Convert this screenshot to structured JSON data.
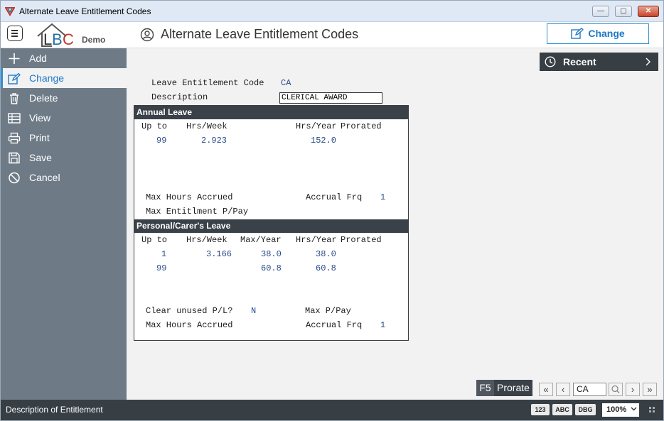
{
  "window": {
    "title": "Alternate Leave Entitlement Codes",
    "buttons": {
      "minimize": "—",
      "maximize": "▢",
      "close": "✕"
    }
  },
  "header": {
    "logo_text": "Demo",
    "page_title": "Alternate Leave Entitlement Codes",
    "mode_button": "Change"
  },
  "sidebar": {
    "items": [
      {
        "label": "Add",
        "icon": "plus-icon"
      },
      {
        "label": "Change",
        "icon": "edit-icon",
        "active": true
      },
      {
        "label": "Delete",
        "icon": "trash-icon"
      },
      {
        "label": "View",
        "icon": "table-icon"
      },
      {
        "label": "Print",
        "icon": "printer-icon"
      },
      {
        "label": "Save",
        "icon": "save-icon"
      },
      {
        "label": "Cancel",
        "icon": "cancel-icon"
      }
    ]
  },
  "recent": {
    "label": "Recent"
  },
  "form": {
    "code_label": "Leave Entitlement Code",
    "code_value": "CA",
    "description_label": "Description",
    "description_value": "CLERICAL AWARD"
  },
  "annual_leave": {
    "header": "Annual Leave",
    "col_upto": "Up to",
    "col_hrs_week": "Hrs/Week",
    "col_hrs_year": "Hrs/Year",
    "col_prorated": "Prorated",
    "rows": [
      {
        "upto": "99",
        "hrs_week": "2.923",
        "hrs_year": "152.0"
      }
    ],
    "max_hours_label": "Max Hours Accrued",
    "accrual_frq_label": "Accrual Frq",
    "accrual_frq_value": "1",
    "max_entitlement_label": "Max Entitlment P/Pay"
  },
  "personal_leave": {
    "header": "Personal/Carer's Leave",
    "col_upto": "Up to",
    "col_hrs_week": "Hrs/Week",
    "col_max_year": "Max/Year",
    "col_hrs_year": "Hrs/Year",
    "col_prorated": "Prorated",
    "rows": [
      {
        "upto": "1",
        "hrs_week": "3.166",
        "max_year": "38.0",
        "hrs_year": "38.0"
      },
      {
        "upto": "99",
        "hrs_week": "",
        "max_year": "60.8",
        "hrs_year": "60.8"
      }
    ],
    "clear_unused_label": "Clear unused P/L?",
    "clear_unused_value": "N",
    "max_ppay_label": "Max P/Pay",
    "max_hours_label": "Max Hours Accrued",
    "accrual_frq_label": "Accrual Frq",
    "accrual_frq_value": "1"
  },
  "footer_tools": {
    "prorate_key": "F5",
    "prorate_label": "Prorate",
    "nav_first": "«",
    "nav_prev": "‹",
    "nav_value": "CA",
    "nav_next": "›",
    "nav_last": "»"
  },
  "statusbar": {
    "text": "Description of Entitlement",
    "badge_numeric": "123",
    "badge_alpha": "ABC",
    "badge_debug": "DBG",
    "zoom": "100%"
  },
  "colors": {
    "accent": "#2f8fd1",
    "sidebar_bg": "#6e7b87",
    "dark_bar": "#373e44",
    "value_text": "#2a4a8a"
  }
}
